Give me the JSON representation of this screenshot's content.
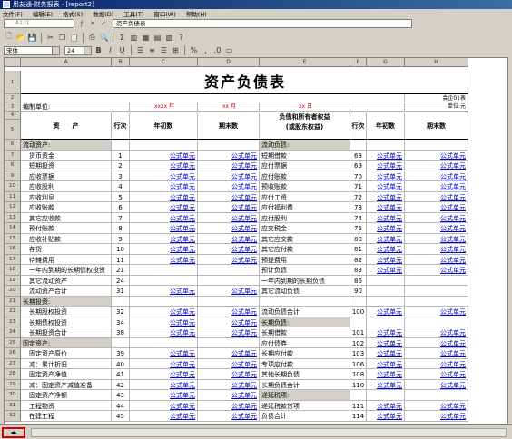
{
  "window": {
    "title": "用友通-财务报表 - [report2]"
  },
  "menu": [
    "文件(F)",
    "编辑(E)",
    "格式(S)",
    "数据(D)",
    "工具(T)",
    "窗口(W)",
    "帮助(H)"
  ],
  "formula_bar": {
    "cell_ref": "A1:I1",
    "formula": "资产负债表"
  },
  "format_bar": {
    "font": "宋体",
    "size": "24"
  },
  "columns": [
    "A",
    "B",
    "C",
    "D",
    "E",
    "F",
    "G",
    "H"
  ],
  "row_numbers": [
    "1",
    "2",
    "3",
    "4",
    "5",
    "6",
    "7",
    "8",
    "9",
    "10",
    "11",
    "12",
    "13",
    "14",
    "15",
    "16",
    "17",
    "18",
    "19",
    "20",
    "21",
    "22",
    "23",
    "24",
    "25",
    "26",
    "27",
    "28",
    "29",
    "30",
    "31",
    "32",
    "33"
  ],
  "sheet": {
    "title": "资产负债表",
    "doc_no": "会企01表",
    "unit_label": "编制单位:",
    "date_year": "xxxx 年",
    "date_month": "xx 月",
    "date_day": "xx 日",
    "currency": "单位:元",
    "header": {
      "asset": "资　　产",
      "line": "行次",
      "begin": "年初数",
      "end": "期末数",
      "liab": "负债和所有者权益",
      "liab_sub": "(或股东权益)",
      "line2": "行次",
      "begin2": "年初数",
      "end2": "期末数"
    },
    "formula_text": "公式单元",
    "rows": [
      {
        "a": "流动资产:",
        "b": "",
        "e": "流动负债:",
        "f": "",
        "la": false,
        "lb": false,
        "ga": true,
        "ge": true
      },
      {
        "a": "　货币资金",
        "b": "1",
        "e": "短期借款",
        "f": "68",
        "la": true,
        "lb": true
      },
      {
        "a": "　短期投资",
        "b": "2",
        "e": "应付票据",
        "f": "69",
        "la": true,
        "lb": true
      },
      {
        "a": "　应收票据",
        "b": "3",
        "e": "应付账款",
        "f": "70",
        "la": true,
        "lb": true
      },
      {
        "a": "　应收股利",
        "b": "4",
        "e": "预收账款",
        "f": "71",
        "la": true,
        "lb": true
      },
      {
        "a": "　应收利息",
        "b": "5",
        "e": "应付工资",
        "f": "72",
        "la": true,
        "lb": true
      },
      {
        "a": "　应收账款",
        "b": "6",
        "e": "应付福利费",
        "f": "73",
        "la": true,
        "lb": true
      },
      {
        "a": "　其它应收款",
        "b": "7",
        "e": "应付股利",
        "f": "74",
        "la": true,
        "lb": true
      },
      {
        "a": "　预付账款",
        "b": "8",
        "e": "应交税金",
        "f": "75",
        "la": true,
        "lb": true
      },
      {
        "a": "　应收补贴款",
        "b": "9",
        "e": "其它应交款",
        "f": "80",
        "la": true,
        "lb": true
      },
      {
        "a": "　存货",
        "b": "10",
        "e": "其它应付款",
        "f": "81",
        "la": true,
        "lb": true
      },
      {
        "a": "　待摊费用",
        "b": "11",
        "e": "预提费用",
        "f": "82",
        "la": true,
        "lb": true
      },
      {
        "a": "　一年内到期的长期债权投资",
        "b": "21",
        "e": "预计负债",
        "f": "83",
        "la": false,
        "lb": true
      },
      {
        "a": "　其它流动资产",
        "b": "24",
        "e": "一年内到期的长期负债",
        "f": "86",
        "la": false,
        "lb": false
      },
      {
        "a": "　流动资产合计",
        "b": "31",
        "e": "其它流动负债",
        "f": "90",
        "la": true,
        "lb": false
      },
      {
        "a": "长期投资:",
        "b": "",
        "e": "",
        "f": "",
        "la": false,
        "lb": false,
        "ga": true
      },
      {
        "a": "　长期股权投资",
        "b": "32",
        "e": "流动负债合计",
        "f": "100",
        "la": true,
        "lb": true
      },
      {
        "a": "　长期债权投资",
        "b": "34",
        "e": "长期负债:",
        "f": "",
        "la": true,
        "lb": false,
        "ge": true
      },
      {
        "a": "　长期投资合计",
        "b": "38",
        "e": "长期借款",
        "f": "101",
        "la": true,
        "lb": true
      },
      {
        "a": "固定资产:",
        "b": "",
        "e": "应付债券",
        "f": "102",
        "la": false,
        "lb": true,
        "ga": true
      },
      {
        "a": "　固定资产原价",
        "b": "39",
        "e": "长期应付款",
        "f": "103",
        "la": true,
        "lb": true
      },
      {
        "a": "　减：累计折旧",
        "b": "40",
        "e": "专项应付款",
        "f": "106",
        "la": true,
        "lb": true
      },
      {
        "a": "　固定资产净值",
        "b": "41",
        "e": "其他长期负债",
        "f": "108",
        "la": true,
        "lb": true
      },
      {
        "a": "　减：固定资产减值准备",
        "b": "42",
        "e": "长期负债合计",
        "f": "110",
        "la": true,
        "lb": true
      },
      {
        "a": "　固定资产净额",
        "b": "43",
        "e": "递延税项:",
        "f": "",
        "la": true,
        "lb": false,
        "ge": true
      },
      {
        "a": "　工程物资",
        "b": "44",
        "e": "递延税款贷项",
        "f": "111",
        "la": true,
        "lb": true
      },
      {
        "a": "　在建工程",
        "b": "45",
        "e": "负债合计",
        "f": "114",
        "la": true,
        "lb": true
      }
    ]
  }
}
